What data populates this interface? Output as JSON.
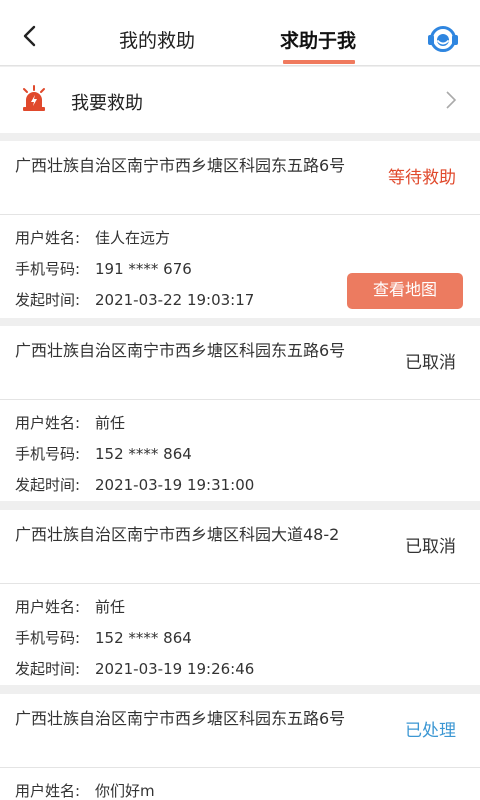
{
  "header": {
    "tabs": [
      {
        "label": "我的救助",
        "active": false
      },
      {
        "label": "求助于我",
        "active": true
      }
    ],
    "accent_color": "#f07a5e",
    "back_icon": "chevron-left-icon",
    "support_icon": "headset-icon"
  },
  "sos": {
    "label": "我要救助",
    "icon": "alarm-siren-icon"
  },
  "labels": {
    "name": "用户姓名:",
    "phone": "手机号码:",
    "time": "发起时间:"
  },
  "requests": [
    {
      "address": "广西壮族自治区南宁市西乡塘区科园东五路6号",
      "status": "等待救助",
      "status_color": "#e0492c",
      "name": "佳人在远方",
      "phone": "191 **** 676",
      "time": "2021-03-22 19:03:17",
      "action": "查看地图"
    },
    {
      "address": "广西壮族自治区南宁市西乡塘区科园东五路6号",
      "status": "已取消",
      "status_color": "#333333",
      "name": "前任",
      "phone": "152 **** 864",
      "time": "2021-03-19 19:31:00"
    },
    {
      "address": "广西壮族自治区南宁市西乡塘区科园大道48-2",
      "status": "已取消",
      "status_color": "#333333",
      "name": "前任",
      "phone": "152 **** 864",
      "time": "2021-03-19 19:26:46"
    },
    {
      "address": "广西壮族自治区南宁市西乡塘区科园东五路6号",
      "status": "已处理",
      "status_color": "#3c97d3",
      "name": "你们好m"
    }
  ]
}
